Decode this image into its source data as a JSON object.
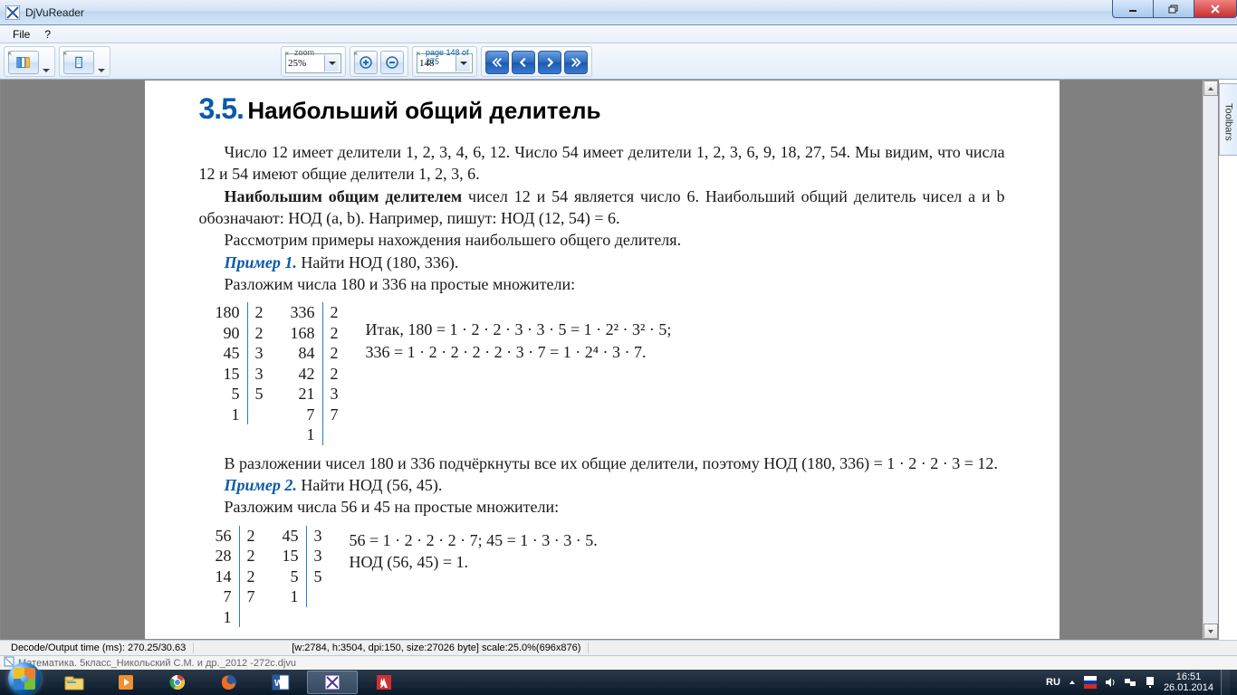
{
  "app": {
    "title": "DjVuReader"
  },
  "menu": {
    "file": "File",
    "help": "?"
  },
  "toolbar": {
    "zoom_label": "zoom",
    "zoom_value": "25%",
    "page_label": "page 148 of 275",
    "page_value": "148"
  },
  "sidebar_tab": "Toolbars",
  "status": {
    "decode": "Decode/Output time (ms): 270.25/30.63",
    "info": "[w:2784, h:3504, dpi:150, size:27026 byte] scale:25.0%(696x876)",
    "doc": "Математика. 5класс_Никольский С.М. и др._2012 -272с.djvu"
  },
  "tray": {
    "lang": "RU",
    "time": "16:51",
    "date": "26.01.2014"
  },
  "page": {
    "section_num": "3.5.",
    "section_title": "Наибольший общий делитель",
    "p1": "Число 12 имеет делители 1, 2, 3, 4, 6, 12. Число 54 имеет делители 1, 2, 3, 6, 9, 18, 27, 54. Мы видим, что числа 12 и 54 имеют общие делители 1, 2, 3, 6.",
    "p2a": "Наибольшим общим делителем",
    "p2b": " чисел 12 и 54 является число 6. Наибольший общий делитель чисел a и b обозначают: НОД (a, b). Например, пишут: НОД (12, 54) = 6.",
    "p3": "Рассмотрим примеры нахождения наибольшего общего делителя.",
    "ex1_label": "Пример 1.",
    "ex1_task": " Найти НОД (180, 336).",
    "ex1_line": "Разложим числа 180 и 336 на простые множители:",
    "f180_n": [
      "180",
      "90",
      "45",
      "15",
      "5",
      "1"
    ],
    "f180_p": [
      "2",
      "2",
      "3",
      "3",
      "5",
      ""
    ],
    "f336_n": [
      "336",
      "168",
      "84",
      "42",
      "21",
      "7",
      "1"
    ],
    "f336_p": [
      "2",
      "2",
      "2",
      "2",
      "3",
      "7",
      ""
    ],
    "aside1": "Итак, 180 = 1 · 2 · 2 · 3 · 3 · 5 = 1 · 2² · 3² · 5;",
    "aside2": "336 = 1 · 2 · 2 · 2 · 2 · 3 · 7 = 1 · 2⁴ · 3 · 7.",
    "p4": "В разложении чисел 180 и 336 подчёркнуты все их общие делители, поэтому НОД (180, 336) = 1 · 2 · 2 · 3 = 12.",
    "ex2_label": "Пример 2.",
    "ex2_task": " Найти НОД (56, 45).",
    "ex2_line": "Разложим числа 56 и 45 на простые множители:",
    "f56_n": [
      "56",
      "28",
      "14",
      "7",
      "1"
    ],
    "f56_p": [
      "2",
      "2",
      "2",
      "7",
      ""
    ],
    "f45_n": [
      "45",
      "15",
      "5",
      "1"
    ],
    "f45_p": [
      "3",
      "3",
      "5",
      ""
    ],
    "aside3": "56 = 1 · 2 · 2 · 2 · 7;  45 = 1 · 3 · 3 · 5.",
    "aside4": "НОД (56, 45) = 1."
  }
}
